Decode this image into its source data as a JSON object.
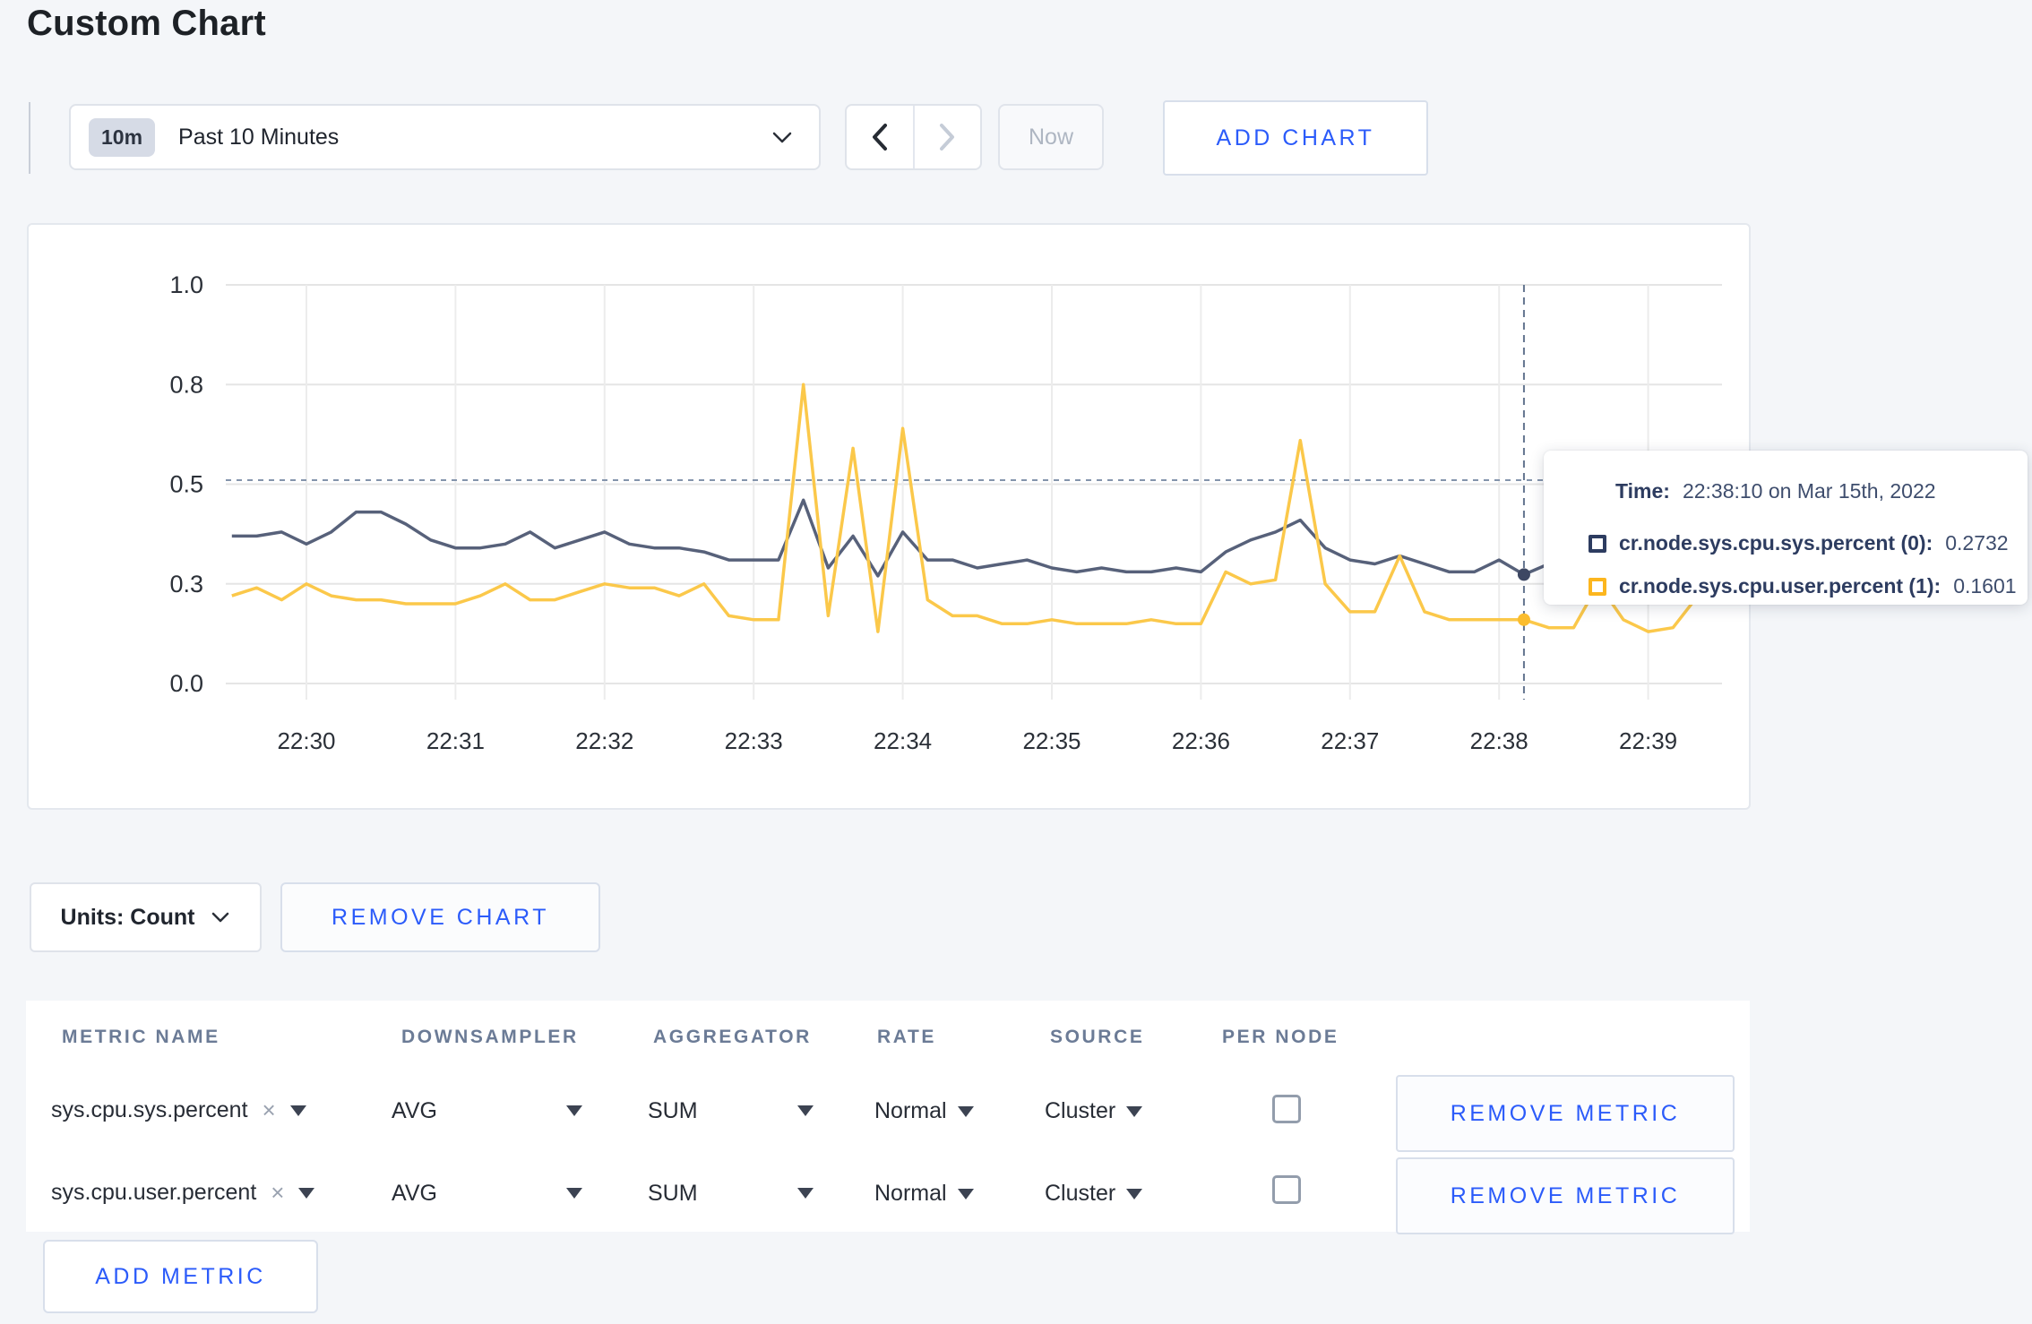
{
  "page": {
    "title": "Custom Chart"
  },
  "toolbar": {
    "time_range": {
      "badge": "10m",
      "label": "Past 10 Minutes"
    },
    "now_label": "Now",
    "add_chart_label": "ADD CHART"
  },
  "chart_data": {
    "type": "line",
    "title": "",
    "ylim": [
      0,
      1
    ],
    "grid": true,
    "y_tick_values": [
      0,
      0.25,
      0.5,
      0.75,
      1.0
    ],
    "y_tick_labels": [
      "0.0",
      "0.3",
      "0.5",
      "0.8",
      "1.0"
    ],
    "x_ticks": [
      "22:30",
      "22:31",
      "22:32",
      "22:33",
      "22:34",
      "22:35",
      "22:36",
      "22:37",
      "22:38",
      "22:39"
    ],
    "x_start_minutes": -0.5,
    "x_step_minutes": 0.166667,
    "series": [
      {
        "name": "cr.node.sys.cpu.sys.percent",
        "color": "#57617a",
        "dot_color": "#3d4763",
        "values": [
          0.37,
          0.37,
          0.38,
          0.35,
          0.38,
          0.43,
          0.43,
          0.4,
          0.36,
          0.34,
          0.34,
          0.35,
          0.38,
          0.34,
          0.36,
          0.38,
          0.35,
          0.34,
          0.34,
          0.33,
          0.31,
          0.31,
          0.31,
          0.46,
          0.29,
          0.37,
          0.27,
          0.38,
          0.31,
          0.31,
          0.29,
          0.3,
          0.31,
          0.29,
          0.28,
          0.29,
          0.28,
          0.28,
          0.29,
          0.28,
          0.33,
          0.36,
          0.38,
          0.41,
          0.34,
          0.31,
          0.3,
          0.32,
          0.3,
          0.28,
          0.28,
          0.31,
          0.2732,
          0.3,
          0.3,
          0.29,
          0.3,
          0.3,
          0.29,
          0.3,
          0.28
        ]
      },
      {
        "name": "cr.node.sys.cpu.user.percent",
        "color": "#fbc84a",
        "dot_color": "#fbbd2e",
        "values": [
          0.22,
          0.24,
          0.21,
          0.25,
          0.22,
          0.21,
          0.21,
          0.2,
          0.2,
          0.2,
          0.22,
          0.25,
          0.21,
          0.21,
          0.23,
          0.25,
          0.24,
          0.24,
          0.22,
          0.25,
          0.17,
          0.16,
          0.16,
          0.75,
          0.17,
          0.59,
          0.13,
          0.64,
          0.21,
          0.17,
          0.17,
          0.15,
          0.15,
          0.16,
          0.15,
          0.15,
          0.15,
          0.16,
          0.15,
          0.15,
          0.28,
          0.25,
          0.26,
          0.61,
          0.25,
          0.18,
          0.18,
          0.32,
          0.18,
          0.16,
          0.16,
          0.16,
          0.1601,
          0.14,
          0.14,
          0.25,
          0.16,
          0.13,
          0.14,
          0.22,
          0.28
        ]
      }
    ],
    "crosshair": {
      "x_minutes": 8.1667,
      "hline_value": 0.51
    }
  },
  "tooltip": {
    "time_label": "Time:",
    "time_value": "22:38:10 on Mar 15th, 2022",
    "rows": [
      {
        "label": "cr.node.sys.cpu.sys.percent (0):",
        "value": "0.2732",
        "color": "#2d3c60"
      },
      {
        "label": "cr.node.sys.cpu.user.percent (1):",
        "value": "0.1601",
        "color": "#fcb61e"
      }
    ]
  },
  "units": {
    "label": "Units: Count"
  },
  "chart_actions": {
    "remove_chart_label": "REMOVE CHART"
  },
  "metrics_table": {
    "headers": [
      "METRIC NAME",
      "DOWNSAMPLER",
      "AGGREGATOR",
      "RATE",
      "SOURCE",
      "PER NODE"
    ],
    "remove_metric_label": "REMOVE METRIC",
    "add_metric_label": "ADD METRIC",
    "rows": [
      {
        "name": "sys.cpu.sys.percent",
        "remove_glyph": "×",
        "downsampler": "AVG",
        "aggregator": "SUM",
        "rate": "Normal",
        "source": "Cluster",
        "per_node_checked": false
      },
      {
        "name": "sys.cpu.user.percent",
        "remove_glyph": "×",
        "downsampler": "AVG",
        "aggregator": "SUM",
        "rate": "Normal",
        "source": "Cluster",
        "per_node_checked": false
      }
    ]
  },
  "colors": {
    "accent_blue": "#2b5bfa",
    "line_sys": "#57617a",
    "line_user": "#fbc84a",
    "grid": "#e5e5e5"
  }
}
